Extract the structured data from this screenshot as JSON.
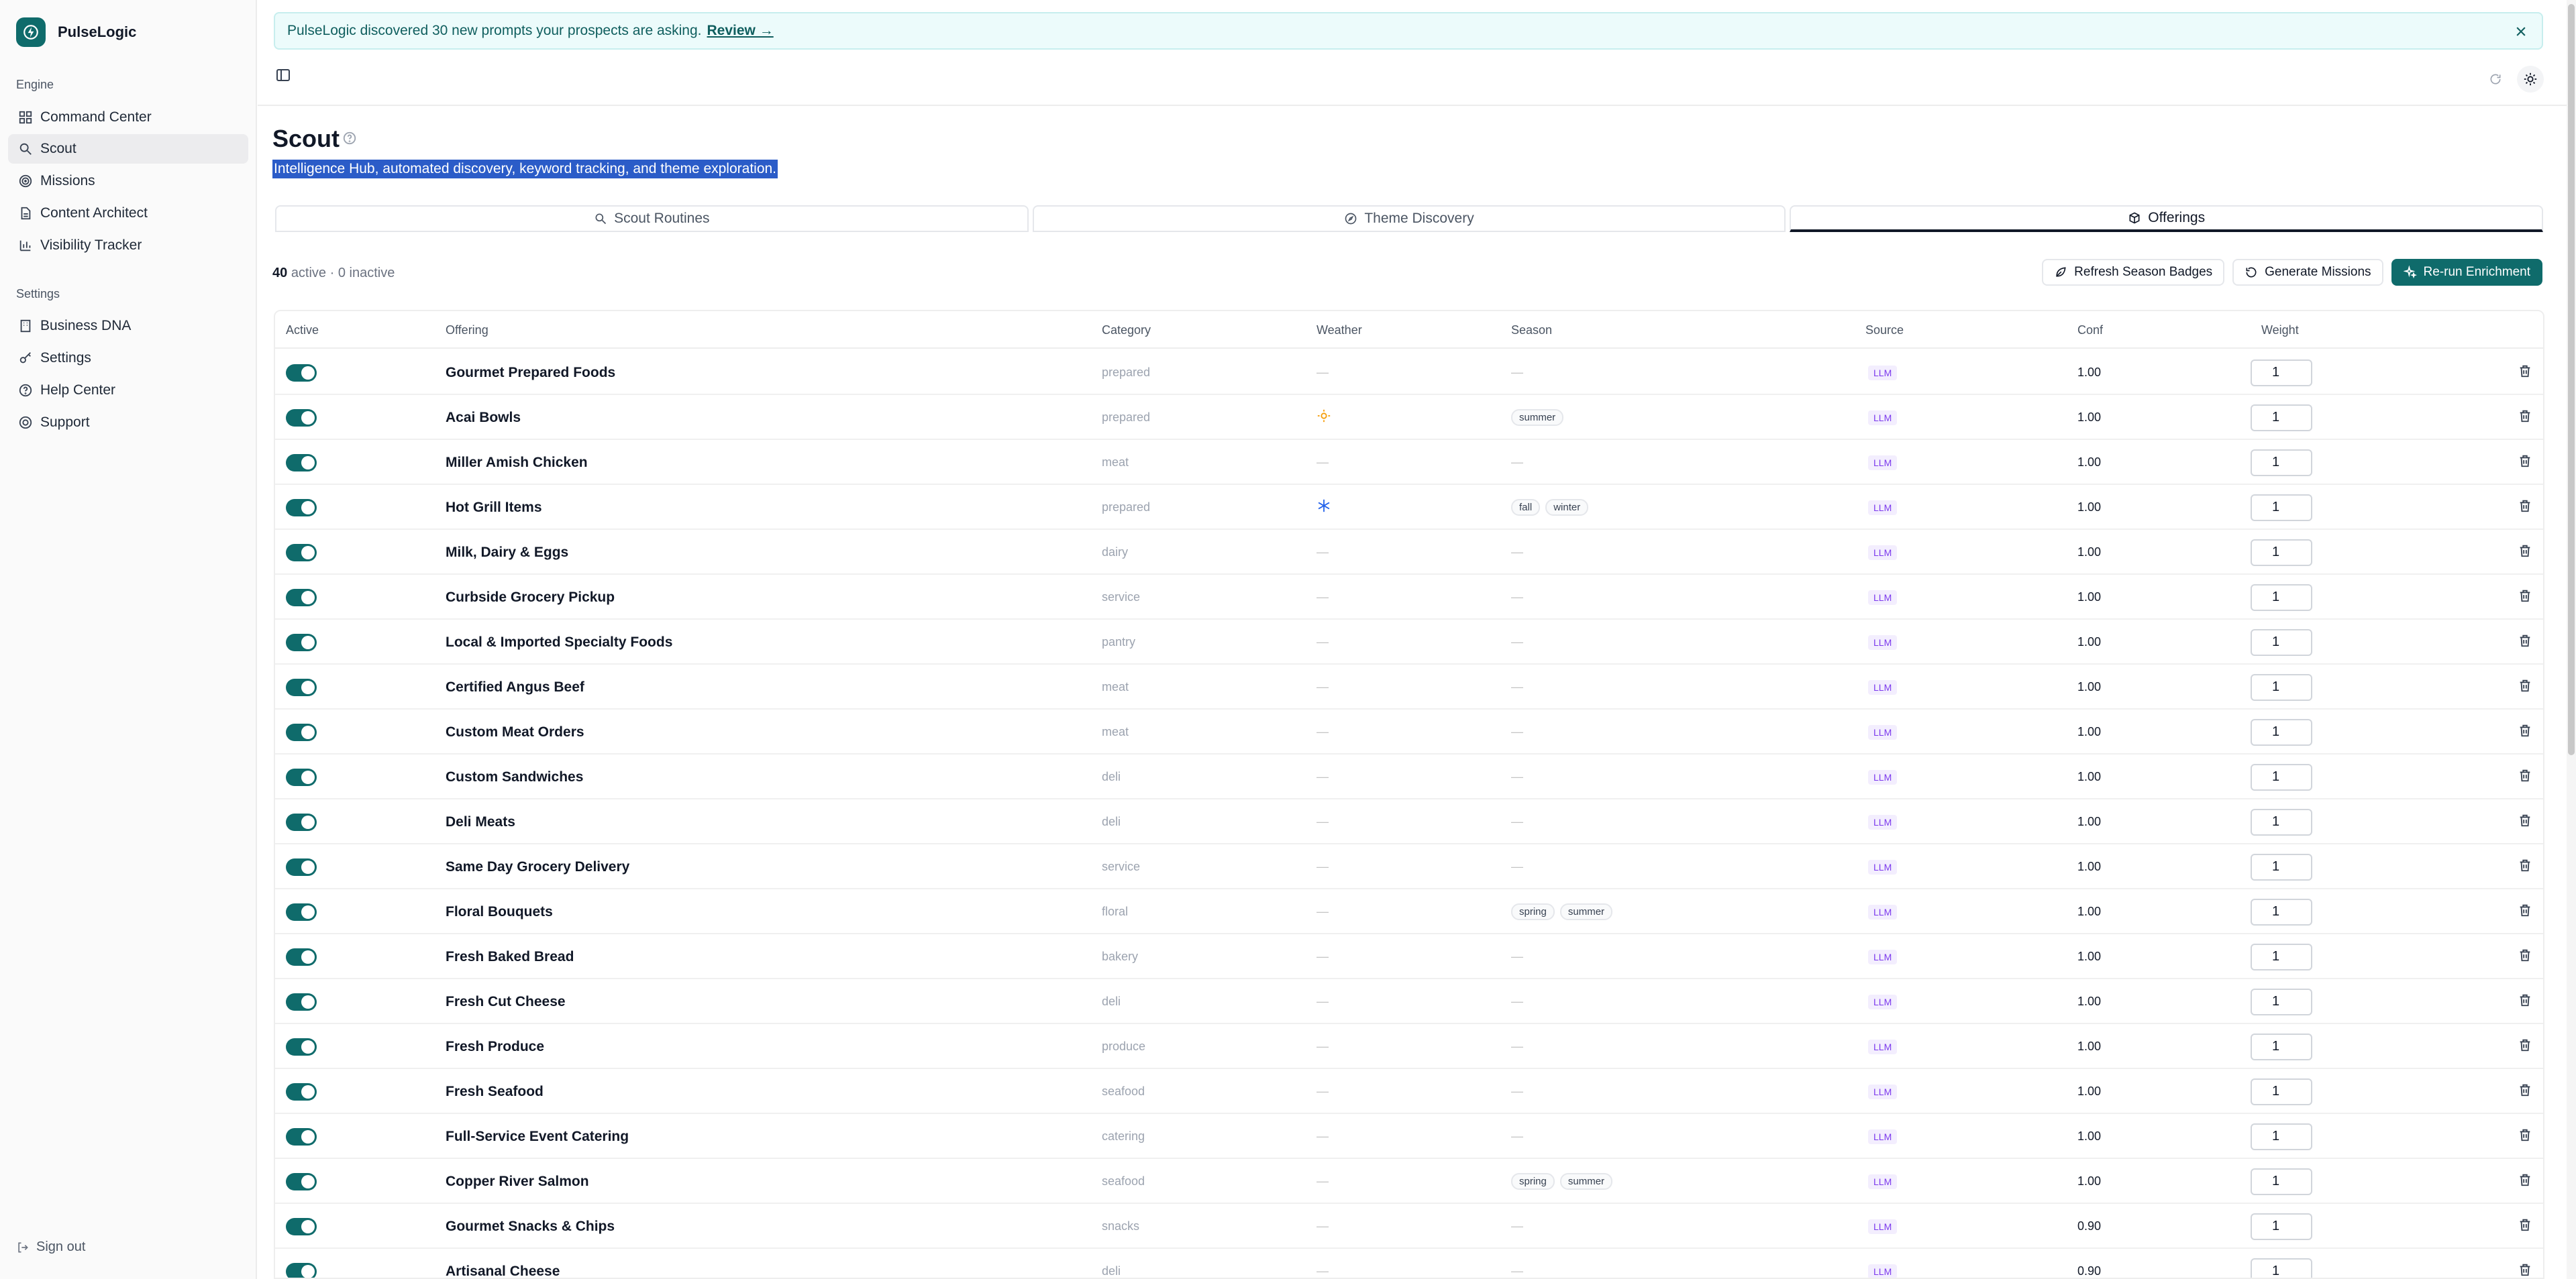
{
  "app": {
    "name": "PulseLogic"
  },
  "sidebar": {
    "sections": [
      {
        "title": "Engine",
        "items": [
          "Command Center",
          "Scout",
          "Missions",
          "Content Architect",
          "Visibility Tracker"
        ]
      },
      {
        "title": "Settings",
        "items": [
          "Business DNA",
          "Settings",
          "Help Center",
          "Support"
        ]
      }
    ],
    "active": "Scout",
    "signout": "Sign out"
  },
  "banner": {
    "text": "PulseLogic discovered 30 new prompts your prospects are asking.",
    "link": "Review →"
  },
  "page": {
    "title": "Scout",
    "subtitle": "Intelligence Hub, automated discovery, keyword tracking, and theme exploration."
  },
  "tabs": [
    {
      "label": "Scout Routines",
      "icon": "search-icon"
    },
    {
      "label": "Theme Discovery",
      "icon": "compass-icon"
    },
    {
      "label": "Offerings",
      "icon": "package-icon",
      "active": true
    }
  ],
  "summary": {
    "active_count": "40",
    "active_word": "active",
    "rest": "· 0 inactive"
  },
  "actions": {
    "refresh": "Refresh Season Badges",
    "generate": "Generate Missions",
    "rerun": "Re-run Enrichment"
  },
  "table": {
    "headers": [
      "Active",
      "Offering",
      "Category",
      "Weather",
      "Season",
      "Source",
      "Conf",
      "Weight"
    ],
    "rows": [
      {
        "name": "Gourmet Prepared Foods",
        "category": "prepared",
        "weather": "—",
        "seasons": [],
        "source": "LLM",
        "conf": "1.00",
        "weight": "1"
      },
      {
        "name": "Acai Bowls",
        "category": "prepared",
        "weather": "sun",
        "seasons": [
          "summer"
        ],
        "source": "LLM",
        "conf": "1.00",
        "weight": "1"
      },
      {
        "name": "Miller Amish Chicken",
        "category": "meat",
        "weather": "—",
        "seasons": [],
        "source": "LLM",
        "conf": "1.00",
        "weight": "1"
      },
      {
        "name": "Hot Grill Items",
        "category": "prepared",
        "weather": "snow",
        "seasons": [
          "fall",
          "winter"
        ],
        "source": "LLM",
        "conf": "1.00",
        "weight": "1"
      },
      {
        "name": "Milk, Dairy & Eggs",
        "category": "dairy",
        "weather": "—",
        "seasons": [],
        "source": "LLM",
        "conf": "1.00",
        "weight": "1"
      },
      {
        "name": "Curbside Grocery Pickup",
        "category": "service",
        "weather": "—",
        "seasons": [],
        "source": "LLM",
        "conf": "1.00",
        "weight": "1"
      },
      {
        "name": "Local & Imported Specialty Foods",
        "category": "pantry",
        "weather": "—",
        "seasons": [],
        "source": "LLM",
        "conf": "1.00",
        "weight": "1"
      },
      {
        "name": "Certified Angus Beef",
        "category": "meat",
        "weather": "—",
        "seasons": [],
        "source": "LLM",
        "conf": "1.00",
        "weight": "1"
      },
      {
        "name": "Custom Meat Orders",
        "category": "meat",
        "weather": "—",
        "seasons": [],
        "source": "LLM",
        "conf": "1.00",
        "weight": "1"
      },
      {
        "name": "Custom Sandwiches",
        "category": "deli",
        "weather": "—",
        "seasons": [],
        "source": "LLM",
        "conf": "1.00",
        "weight": "1"
      },
      {
        "name": "Deli Meats",
        "category": "deli",
        "weather": "—",
        "seasons": [],
        "source": "LLM",
        "conf": "1.00",
        "weight": "1"
      },
      {
        "name": "Same Day Grocery Delivery",
        "category": "service",
        "weather": "—",
        "seasons": [],
        "source": "LLM",
        "conf": "1.00",
        "weight": "1"
      },
      {
        "name": "Floral Bouquets",
        "category": "floral",
        "weather": "—",
        "seasons": [
          "spring",
          "summer"
        ],
        "source": "LLM",
        "conf": "1.00",
        "weight": "1"
      },
      {
        "name": "Fresh Baked Bread",
        "category": "bakery",
        "weather": "—",
        "seasons": [],
        "source": "LLM",
        "conf": "1.00",
        "weight": "1"
      },
      {
        "name": "Fresh Cut Cheese",
        "category": "deli",
        "weather": "—",
        "seasons": [],
        "source": "LLM",
        "conf": "1.00",
        "weight": "1"
      },
      {
        "name": "Fresh Produce",
        "category": "produce",
        "weather": "—",
        "seasons": [],
        "source": "LLM",
        "conf": "1.00",
        "weight": "1"
      },
      {
        "name": "Fresh Seafood",
        "category": "seafood",
        "weather": "—",
        "seasons": [],
        "source": "LLM",
        "conf": "1.00",
        "weight": "1"
      },
      {
        "name": "Full-Service Event Catering",
        "category": "catering",
        "weather": "—",
        "seasons": [],
        "source": "LLM",
        "conf": "1.00",
        "weight": "1"
      },
      {
        "name": "Copper River Salmon",
        "category": "seafood",
        "weather": "—",
        "seasons": [
          "spring",
          "summer"
        ],
        "source": "LLM",
        "conf": "1.00",
        "weight": "1"
      },
      {
        "name": "Gourmet Snacks & Chips",
        "category": "snacks",
        "weather": "—",
        "seasons": [],
        "source": "LLM",
        "conf": "0.90",
        "weight": "1"
      },
      {
        "name": "Artisanal Cheese",
        "category": "deli",
        "weather": "—",
        "seasons": [],
        "source": "LLM",
        "conf": "0.90",
        "weight": "1"
      }
    ]
  },
  "colors": {
    "accent": "#0f6b6b",
    "sun": "#f59e0b",
    "snow": "#2563eb",
    "source_badge": "#7c3aed"
  }
}
